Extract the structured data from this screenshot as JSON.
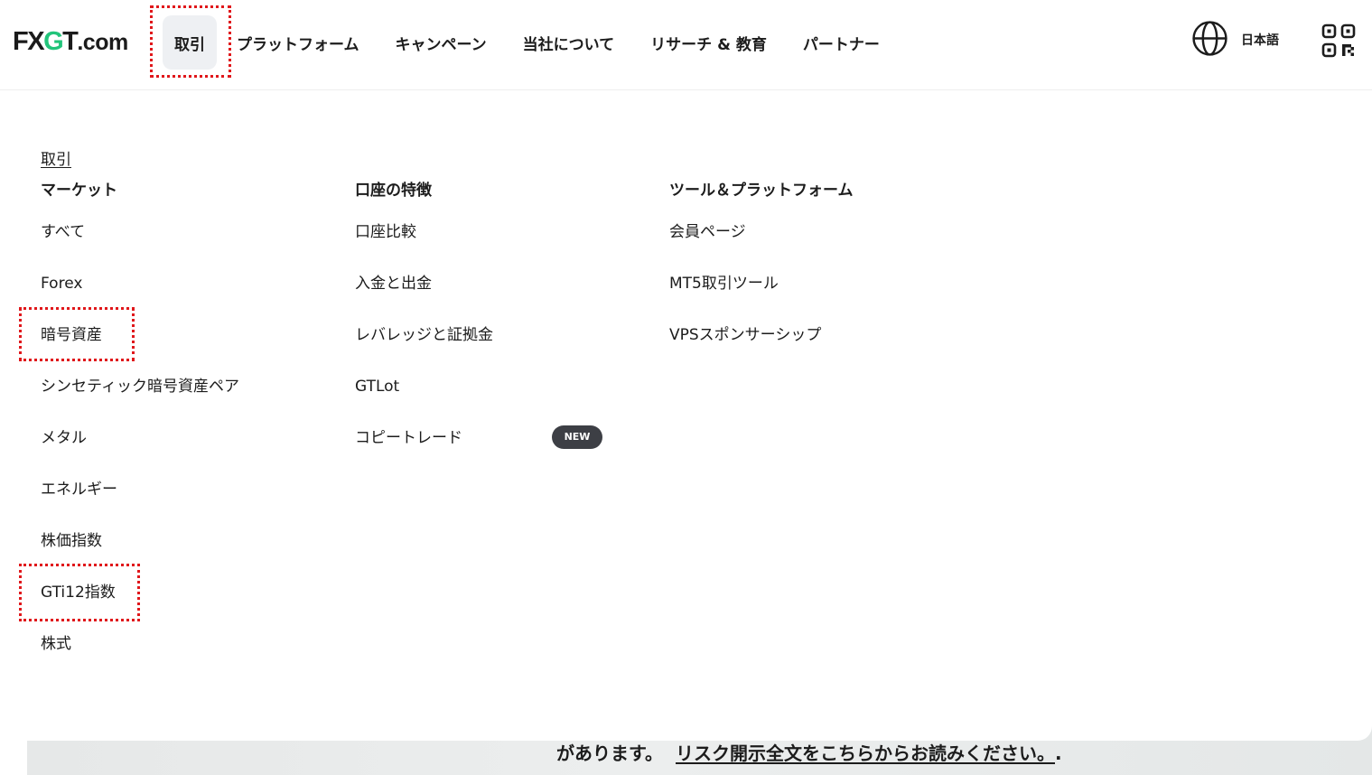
{
  "brand": {
    "logo_fx": "FX",
    "logo_g": "G",
    "logo_t": "T",
    "logo_com": ".com",
    "accent": "#22c47a"
  },
  "nav": {
    "items": [
      "取引",
      "プラットフォーム",
      "キャンペーン",
      "当社について",
      "リサーチ & 教育",
      "パートナー"
    ],
    "language": "日本語"
  },
  "icons": {
    "globe": "globe-icon",
    "qr": "qr-code-icon"
  },
  "menu": {
    "breadcrumb": "取引",
    "columns": [
      {
        "heading": "マーケット",
        "items": [
          "すべて",
          "Forex",
          "暗号資産",
          "シンセティック暗号資産ペア",
          "メタル",
          "エネルギー",
          "株価指数",
          "GTi12指数",
          "株式"
        ]
      },
      {
        "heading": "口座の特徴",
        "items": [
          "口座比較",
          "入金と出金",
          "レバレッジと証拠金",
          "GTLot",
          "コピートレード"
        ],
        "badge": "NEW"
      },
      {
        "heading": "ツール＆プラットフォーム",
        "items": [
          "会員ページ",
          "MT5取引ツール",
          "VPSスポンサーシップ"
        ]
      }
    ]
  },
  "background": {
    "risk_text": "があります。",
    "risk_link": "リスク開示全文をこちらからお読みください。",
    "risk_end": "."
  },
  "highlight_color": "#e0171b"
}
